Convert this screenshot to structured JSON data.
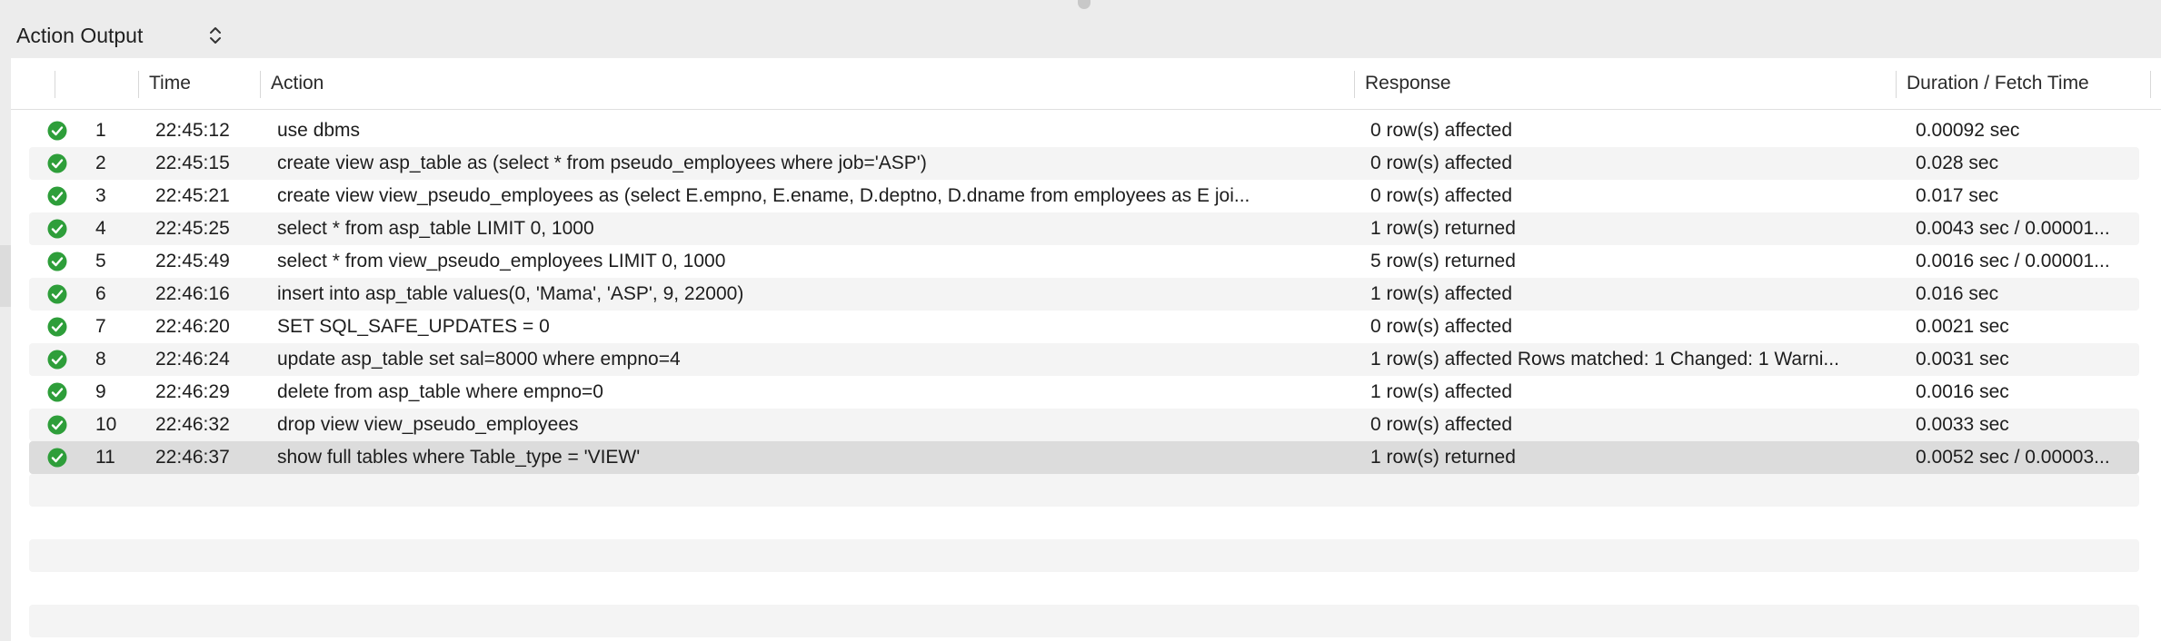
{
  "panel": {
    "selector_label": "Action Output"
  },
  "columns": {
    "time": "Time",
    "action": "Action",
    "response": "Response",
    "duration": "Duration / Fetch Time"
  },
  "rows": [
    {
      "num": "1",
      "time": "22:45:12",
      "action": "use dbms",
      "response": "0 row(s) affected",
      "duration": "0.00092 sec",
      "status": "success"
    },
    {
      "num": "2",
      "time": "22:45:15",
      "action": "create view asp_table as (select * from pseudo_employees where job='ASP')",
      "response": "0 row(s) affected",
      "duration": "0.028 sec",
      "status": "success"
    },
    {
      "num": "3",
      "time": "22:45:21",
      "action": "create view view_pseudo_employees as  (select E.empno, E.ename, D.deptno, D.dname from employees as E joi...",
      "response": "0 row(s) affected",
      "duration": "0.017 sec",
      "status": "success"
    },
    {
      "num": "4",
      "time": "22:45:25",
      "action": "select * from asp_table LIMIT 0, 1000",
      "response": "1 row(s) returned",
      "duration": "0.0043 sec / 0.00001...",
      "status": "success"
    },
    {
      "num": "5",
      "time": "22:45:49",
      "action": "select * from view_pseudo_employees LIMIT 0, 1000",
      "response": "5 row(s) returned",
      "duration": "0.0016 sec / 0.00001...",
      "status": "success"
    },
    {
      "num": "6",
      "time": "22:46:16",
      "action": "insert into asp_table values(0, 'Mama', 'ASP', 9, 22000)",
      "response": "1 row(s) affected",
      "duration": "0.016 sec",
      "status": "success"
    },
    {
      "num": "7",
      "time": "22:46:20",
      "action": "SET SQL_SAFE_UPDATES = 0",
      "response": "0 row(s) affected",
      "duration": "0.0021 sec",
      "status": "success"
    },
    {
      "num": "8",
      "time": "22:46:24",
      "action": "update asp_table  set sal=8000 where empno=4",
      "response": "1 row(s) affected Rows matched: 1  Changed: 1  Warni...",
      "duration": "0.0031 sec",
      "status": "success"
    },
    {
      "num": "9",
      "time": "22:46:29",
      "action": "delete from asp_table where empno=0",
      "response": "1 row(s) affected",
      "duration": "0.0016 sec",
      "status": "success"
    },
    {
      "num": "10",
      "time": "22:46:32",
      "action": "drop view view_pseudo_employees",
      "response": "0 row(s) affected",
      "duration": "0.0033 sec",
      "status": "success"
    },
    {
      "num": "11",
      "time": "22:46:37",
      "action": "show full tables where Table_type = 'VIEW'",
      "response": "1 row(s) returned",
      "duration": "0.0052 sec / 0.00003...",
      "status": "success",
      "selected": true
    }
  ],
  "colors": {
    "success_icon": "#2e9e3a",
    "selected_row": "#dcdcdc",
    "alt_row": "#f4f4f4"
  },
  "icons": {
    "status": "checkmark-circle-icon",
    "selector": "chevron-updown-icon"
  }
}
